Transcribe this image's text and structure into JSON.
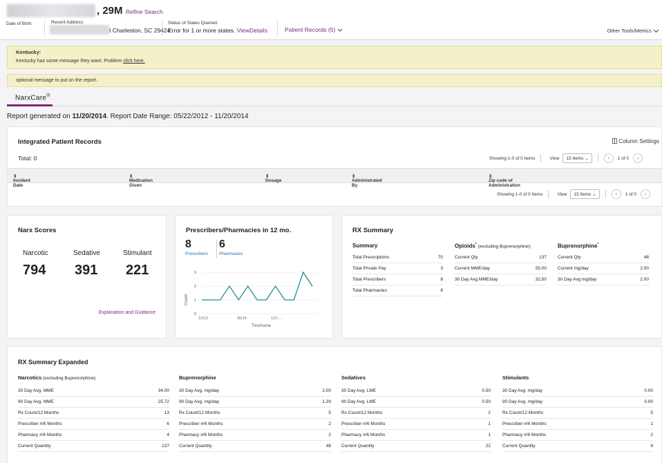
{
  "header": {
    "name_suffix": ", 29M",
    "refine_label": "Refine Search",
    "dob_label": "Date of Birth:",
    "address_label": "Recent Address:",
    "address_value": "t Charleston, SC 29424",
    "status_label": "Status of States Queried:",
    "status_text": "Error for 1 or more states.",
    "status_link": "ViewDetails",
    "patient_records_label": "Patient Records (5)",
    "other_tools_label": "Other Tools/Metrics"
  },
  "banners": {
    "kentucky_title": "Kentucky:",
    "kentucky_message": "Kentucky has some message they want. Problem",
    "kentucky_link": "click here.",
    "optional_message": "optional message to put on the report."
  },
  "tabs": {
    "narxcare_label": "NarxCare",
    "narxcare_mark": "®"
  },
  "report": {
    "prefix": "Report generated on ",
    "date": "11/20/2014",
    "suffix": ". Report Date Range: 05/22/2012 - 11/20/2014"
  },
  "ipr": {
    "title": "Integrated Patient Records",
    "column_settings": "Column Settings",
    "total": "Total: 0",
    "showing": "Showing 1-0 of 0 Items",
    "view_label": "View",
    "view_value": "15 Items",
    "page_of": "1 of 0",
    "columns": [
      "Incident Date",
      "Medication Given",
      "Dosage",
      "Administrated By",
      "Zip code of Administration"
    ]
  },
  "narx": {
    "title": "Narx Scores",
    "labels": [
      "Narcotic",
      "Sedative",
      "Stimulant"
    ],
    "values": [
      "794",
      "391",
      "221"
    ],
    "explanation_link": "Explanation and Guidance"
  },
  "prescribers": {
    "title": "Prescribers/Pharmacies in 12 mo.",
    "prescriber_count": "8",
    "pharmacy_count": "6",
    "prescriber_label": "Prescribers",
    "pharmacy_label": "Pharmacies"
  },
  "chart_data": {
    "type": "line",
    "title": "",
    "xlabel": "Timeframe",
    "ylabel": "Count",
    "ylim": [
      0,
      3
    ],
    "yticks": [
      "0",
      "1",
      "2",
      "3"
    ],
    "xticks": [
      "12/13",
      "06/14",
      "11/1…"
    ],
    "series": [
      {
        "style": "solid",
        "x": [
          0,
          1,
          2,
          3,
          4,
          5,
          6,
          7,
          8,
          9,
          10,
          11,
          12
        ],
        "values": [
          1,
          1,
          1,
          2,
          1,
          2,
          1,
          1,
          2,
          1,
          1,
          3,
          2
        ]
      },
      {
        "style": "dashed",
        "x": [
          11,
          12
        ],
        "values": [
          3,
          2
        ]
      }
    ],
    "line_color": "#1a8a8a",
    "grid": true
  },
  "rx_summary": {
    "title": "RX Summary",
    "summary": {
      "title": "Summary",
      "rows": [
        {
          "label": "Total Prescriptions",
          "value": "70"
        },
        {
          "label": "Total Private Pay",
          "value": "3"
        },
        {
          "label": "Total Prescribers",
          "value": "8"
        },
        {
          "label": "Total Pharmacies",
          "value": "8"
        }
      ]
    },
    "opioids": {
      "title": "Opioids",
      "mark": "*",
      "subtitle": " (excluding Buprenorphine)",
      "rows": [
        {
          "label": "Current Qty",
          "value": "137"
        },
        {
          "label": "Current MME/day",
          "value": "55.00"
        },
        {
          "label": "30 Day Avg MME/day",
          "value": "32.50"
        }
      ]
    },
    "buprenorphine": {
      "title": "Buprenorphine",
      "mark": "*",
      "rows": [
        {
          "label": "Current Qty",
          "value": "48"
        },
        {
          "label": "Current mg/day",
          "value": "2.00"
        },
        {
          "label": "30 Day Avg mg/day",
          "value": "2.00"
        }
      ]
    }
  },
  "expanded": {
    "title": "RX Summary Expanded",
    "sections": [
      {
        "title": "Narcotics",
        "subtitle": " (excluding Buprenorphine)",
        "rows": [
          {
            "label": "30 Day Avg. MME",
            "value": "34.00"
          },
          {
            "label": "90 Day Avg. MME",
            "value": "25.72"
          },
          {
            "label": "Rx Count/12 Months",
            "value": "13"
          },
          {
            "label": "Prescriber #/6 Months",
            "value": "6"
          },
          {
            "label": "Pharmacy #/6 Months",
            "value": "4"
          },
          {
            "label": "Current Quantity",
            "value": "137"
          }
        ]
      },
      {
        "title": "Buprenorphine",
        "subtitle": "",
        "rows": [
          {
            "label": "30 Day Avg. mg/day",
            "value": "2.00"
          },
          {
            "label": "90 Day Avg. mg/day",
            "value": "1.29"
          },
          {
            "label": "Rx Count/12 Months",
            "value": "5"
          },
          {
            "label": "Prescriber #/6 Months",
            "value": "2"
          },
          {
            "label": "Pharmacy #/6 Months",
            "value": "2"
          },
          {
            "label": "Current Quantity",
            "value": "48"
          }
        ]
      },
      {
        "title": "Sedatives",
        "subtitle": "",
        "rows": [
          {
            "label": "30 Day Avg. LME",
            "value": "0.50"
          },
          {
            "label": "90 Day Avg. LME",
            "value": "0.50"
          },
          {
            "label": "Rx Count/12 Months",
            "value": "2"
          },
          {
            "label": "Prescriber #/6 Months",
            "value": "1"
          },
          {
            "label": "Pharmacy #/6 Months",
            "value": "1"
          },
          {
            "label": "Current Quantity",
            "value": "22"
          }
        ]
      },
      {
        "title": "Stimulants",
        "subtitle": "",
        "rows": [
          {
            "label": "30 Day Avg. mg/day",
            "value": "0.00"
          },
          {
            "label": "90 Day Avg. mg/day",
            "value": "0.00"
          },
          {
            "label": "Rx Count/12 Months",
            "value": "5"
          },
          {
            "label": "Prescriber #/6 Months",
            "value": "1"
          },
          {
            "label": "Pharmacy #/6 Months",
            "value": "2"
          },
          {
            "label": "Current Quantity",
            "value": "9"
          }
        ]
      }
    ]
  }
}
